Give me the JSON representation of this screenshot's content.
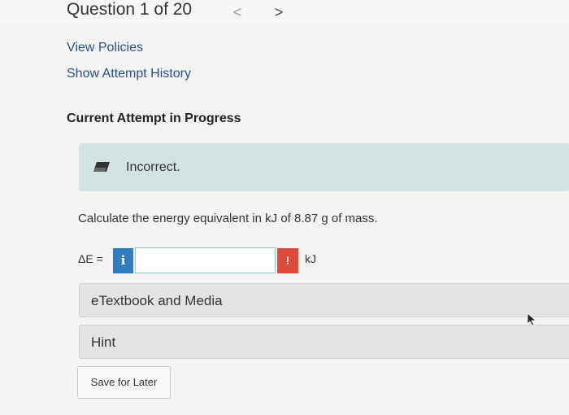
{
  "header": {
    "question_title": "Question 1 of 20",
    "prev_icon": "chevron-left",
    "next_icon": "chevron-right",
    "prev_glyph": "<",
    "next_glyph": ">"
  },
  "links": {
    "view_policies": "View Policies",
    "show_attempt_history": "Show Attempt History"
  },
  "attempt": {
    "heading": "Current Attempt in Progress",
    "feedback_icon": "pencil-eraser-icon",
    "feedback_text": "Incorrect.",
    "feedback_bg": "#d3e3e4"
  },
  "question": {
    "text": "Calculate the energy equivalent in kJ of 8.87 g of mass.",
    "answer_label": "ΔE =",
    "info_glyph": "i",
    "answer_value": "",
    "alert_glyph": "!",
    "alert_color": "#e04a3a",
    "info_color": "#2f7dbf",
    "unit": "kJ"
  },
  "sections": {
    "etextbook": "eTextbook and Media",
    "hint": "Hint"
  },
  "actions": {
    "save_for_later": "Save for Later"
  }
}
